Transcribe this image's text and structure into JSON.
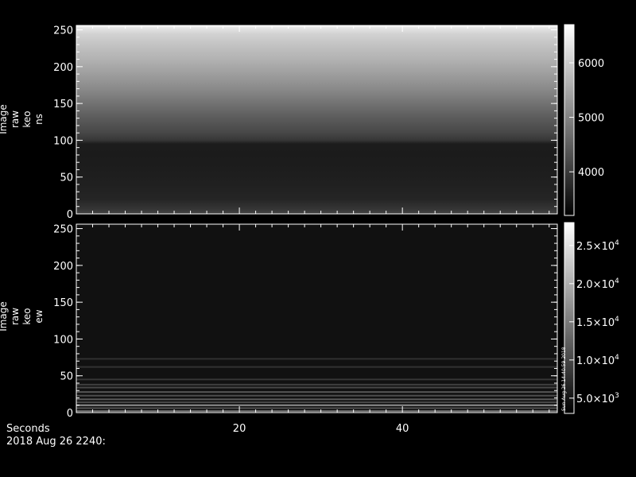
{
  "chart_data": [
    {
      "type": "heatmap",
      "ylabel": [
        "Image",
        "raw",
        "keo",
        "ns"
      ],
      "ylim": [
        0,
        256
      ],
      "y_ticks": [
        "0",
        "50",
        "100",
        "150",
        "200",
        "250"
      ],
      "colorbar": {
        "range": [
          3200,
          6700
        ],
        "ticks": [
          {
            "value": 4000,
            "label": "4000"
          },
          {
            "value": 5000,
            "label": "5000"
          },
          {
            "value": 6000,
            "label": "6000"
          }
        ]
      },
      "rows": [
        {
          "y": 0,
          "value": 3900
        },
        {
          "y": 8,
          "value": 3650
        },
        {
          "y": 20,
          "value": 3450
        },
        {
          "y": 40,
          "value": 3380
        },
        {
          "y": 60,
          "value": 3330
        },
        {
          "y": 80,
          "value": 3300
        },
        {
          "y": 95,
          "value": 3320
        },
        {
          "y": 100,
          "value": 3700
        },
        {
          "y": 110,
          "value": 3950
        },
        {
          "y": 130,
          "value": 4250
        },
        {
          "y": 150,
          "value": 4600
        },
        {
          "y": 170,
          "value": 4950
        },
        {
          "y": 190,
          "value": 5250
        },
        {
          "y": 210,
          "value": 5550
        },
        {
          "y": 230,
          "value": 5800
        },
        {
          "y": 245,
          "value": 6050
        },
        {
          "y": 252,
          "value": 6300
        },
        {
          "y": 256,
          "value": 6600
        }
      ]
    },
    {
      "type": "heatmap",
      "ylabel": [
        "Image",
        "raw",
        "keo",
        "ew"
      ],
      "ylim": [
        0,
        256
      ],
      "y_ticks": [
        "0",
        "50",
        "100",
        "150",
        "200",
        "250"
      ],
      "colorbar": {
        "range": [
          3000,
          28000
        ],
        "ticks": [
          {
            "value": 5000,
            "mant": "5.0×10",
            "exp": "3"
          },
          {
            "value": 10000,
            "mant": "1.0×10",
            "exp": "4"
          },
          {
            "value": 15000,
            "mant": "1.5×10",
            "exp": "4"
          },
          {
            "value": 20000,
            "mant": "2.0×10",
            "exp": "4"
          },
          {
            "value": 25000,
            "mant": "2.5×10",
            "exp": "4"
          }
        ]
      },
      "background_value": 4200,
      "streaks": [
        {
          "y": 2,
          "value": 9000
        },
        {
          "y": 6,
          "value": 7000
        },
        {
          "y": 10,
          "value": 11000
        },
        {
          "y": 14,
          "value": 6500
        },
        {
          "y": 18,
          "value": 7500
        },
        {
          "y": 23,
          "value": 6800
        },
        {
          "y": 28,
          "value": 7200
        },
        {
          "y": 34,
          "value": 6400
        },
        {
          "y": 38,
          "value": 6000
        },
        {
          "y": 45,
          "value": 5300
        },
        {
          "y": 62,
          "value": 5100
        },
        {
          "y": 73,
          "value": 5000
        }
      ]
    }
  ],
  "x_axis": {
    "label": "Seconds",
    "date_label": "2018 Aug 26 2240:",
    "xlim": [
      0,
      59
    ],
    "ticks": [
      {
        "value": 20,
        "label": "20"
      },
      {
        "value": 40,
        "label": "40"
      }
    ]
  },
  "side_stamp": "Sun Aug 26 14:40:59 2018"
}
